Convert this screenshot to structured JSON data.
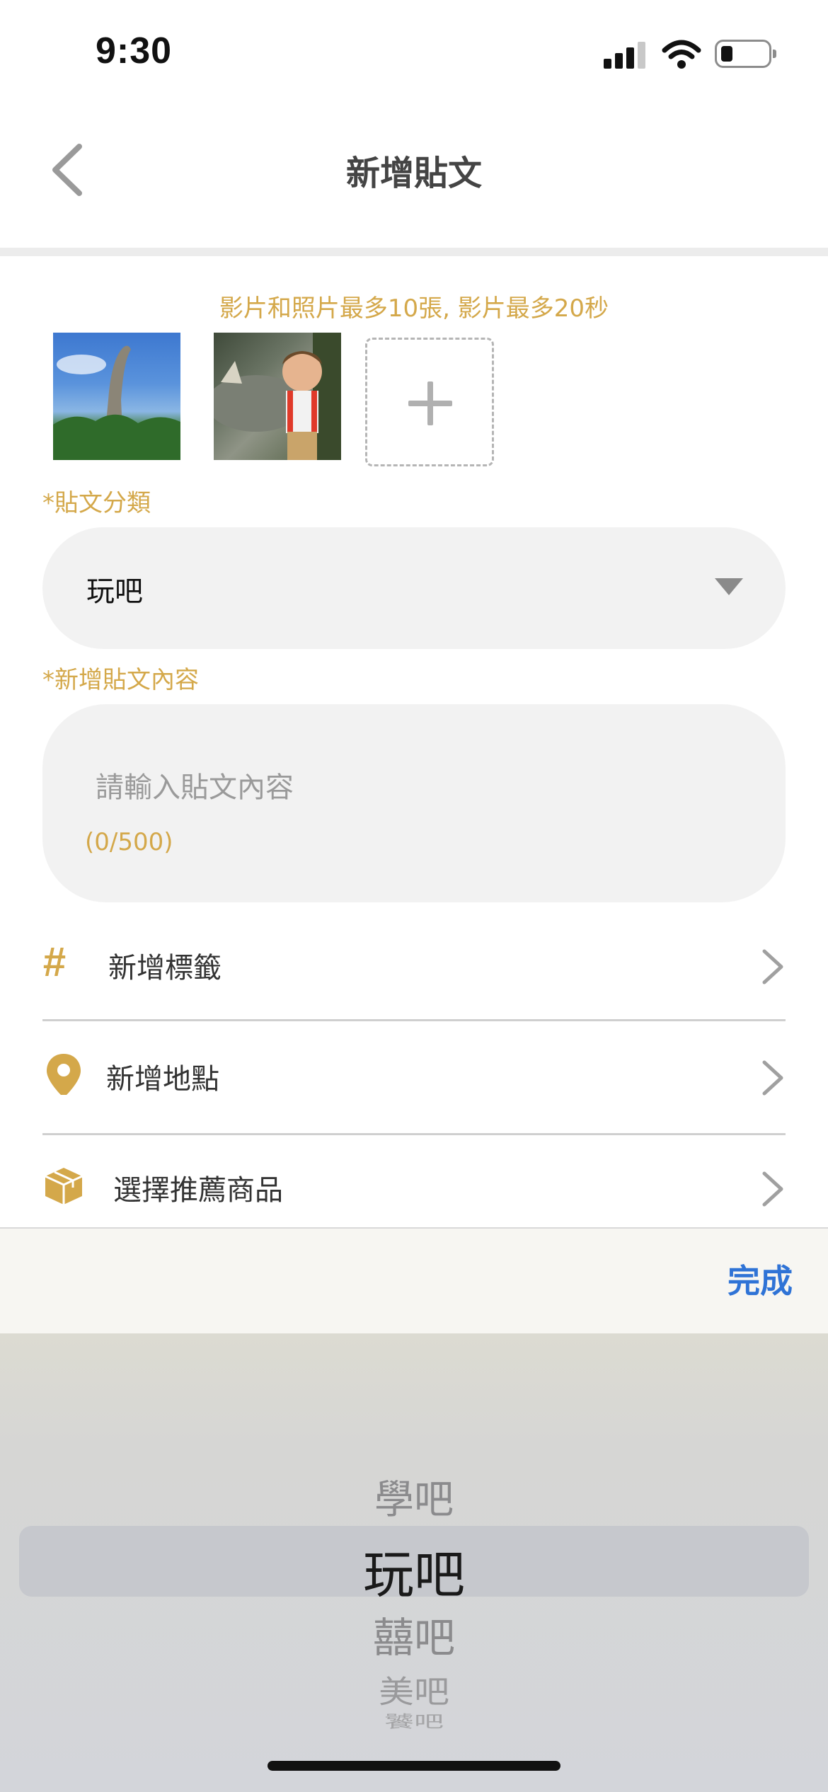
{
  "status_bar": {
    "time": "9:30"
  },
  "nav": {
    "title": "新增貼文"
  },
  "media": {
    "hint": "影片和照片最多10張, 影片最多20秒"
  },
  "category": {
    "label": "*貼文分類",
    "selected": "玩吧"
  },
  "content": {
    "label": "*新增貼文內容",
    "placeholder": "請輸入貼文內容",
    "counter": "(0/500)"
  },
  "options": [
    {
      "label": "新增標籤",
      "icon": "hashtag-icon"
    },
    {
      "label": "新增地點",
      "icon": "location-pin-icon"
    },
    {
      "label": "選擇推薦商品",
      "icon": "package-icon"
    }
  ],
  "toolbar": {
    "done_label": "完成"
  },
  "picker": {
    "items": [
      "學吧",
      "玩吧",
      "囍吧",
      "美吧",
      "饕吧"
    ],
    "selected": "玩吧"
  },
  "colors": {
    "accent": "#d4a84a",
    "link": "#2f73d6",
    "field_bg": "#f2f2f2"
  }
}
